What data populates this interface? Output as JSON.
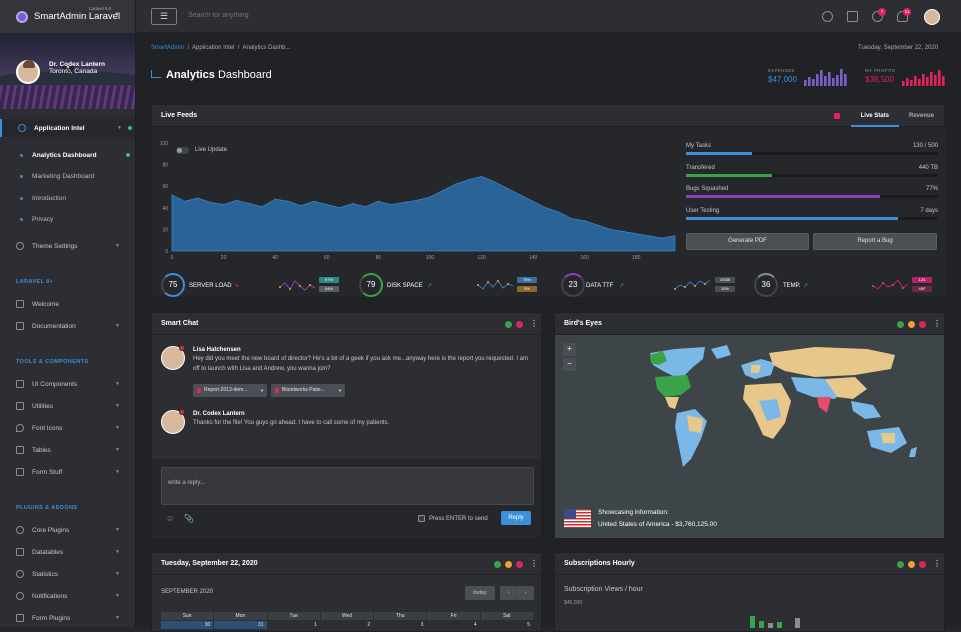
{
  "app": {
    "name": "SmartAdmin Laravel",
    "version": "Laravel 8.0"
  },
  "profile": {
    "name": "Dr. Codex Lantern",
    "location": "Toronto, Canada"
  },
  "sidebar": {
    "app_intel": "Application Intel",
    "sub_items": [
      "Analytics Dashboard",
      "Marketing Dashboard",
      "Introduction",
      "Privacy"
    ],
    "theme_settings": "Theme Settings",
    "section_laravel": "LARAVEL 8+",
    "welcome": "Welcome",
    "documentation": "Documentation",
    "section_tools": "TOOLS & COMPONENTS",
    "tools": [
      "UI Components",
      "Utilities",
      "Font Icons",
      "Tables",
      "Form Stuff"
    ],
    "section_plugins": "PLUGINS & ADDONS",
    "plugins": [
      "Core Plugins",
      "Datatables",
      "Statistics",
      "Notifications",
      "Form Plugins"
    ]
  },
  "topbar": {
    "search_placeholder": "Search for anything",
    "globe_badge": "7",
    "bell_badge": "11"
  },
  "breadcrumb": {
    "home": "SmartAdmin",
    "sep": "/",
    "section": "Application Intel",
    "page": "Analytics Dashb..."
  },
  "date": "Tuesday, September 22, 2020",
  "page": {
    "title_bold": "Analytics",
    "title_rest": "Dashboard"
  },
  "stats": {
    "expenses_label": "EXPENSES",
    "expenses_value": "$47,000",
    "expenses_color": "#7b5fc9",
    "profits_label": "MY PROFITS",
    "profits_value": "$38,500",
    "profits_color": "#e0245e"
  },
  "live_feeds": {
    "title": "Live Feeds",
    "tabs": [
      "Live Stats",
      "Revenue"
    ],
    "live_update": "Live Update",
    "y_ticks": [
      "100",
      "80",
      "60",
      "40",
      "20",
      "0"
    ],
    "x_ticks": [
      "0",
      "20",
      "40",
      "60",
      "80",
      "100",
      "120",
      "140",
      "160",
      "180"
    ],
    "progress": [
      {
        "label": "My Tasks",
        "value": "130 / 500",
        "fill": 0.26,
        "color": "#3c8fdb"
      },
      {
        "label": "Transfered",
        "value": "440 TB",
        "fill": 0.34,
        "color": "#3aa34a"
      },
      {
        "label": "Bugs Squashed",
        "value": "77%",
        "fill": 0.77,
        "color": "#8e3fbd"
      },
      {
        "label": "User Testing",
        "value": "7 days",
        "fill": 0.84,
        "color": "#3c8fdb"
      }
    ],
    "buttons": [
      "Generate PDF",
      "Report a Bug"
    ],
    "kpis": [
      {
        "value": "75",
        "label": "SERVER LOAD",
        "badges": [
          "97%",
          "44%"
        ],
        "color": "#3c8fdb"
      },
      {
        "value": "79",
        "label": "DISK SPACE",
        "badges": [
          "76%",
          "3%"
        ],
        "color": "#3aa34a"
      },
      {
        "value": "23",
        "label": "DATA TTF",
        "badges": [
          "10GB",
          "10%"
        ],
        "color": "#8e3fbd"
      },
      {
        "value": "36",
        "label": "TEMP.",
        "badges": [
          "124",
          "40F"
        ],
        "color": "#777a80"
      }
    ]
  },
  "chat": {
    "title": "Smart Chat",
    "messages": [
      {
        "name": "Lisa Hatchensen",
        "text": "Hey did you meet the new board of director? He's a bit of a geek if you ask me...anyway here is the report you requested. I am off to launch with Lisa and Andrew, you wanna join?"
      },
      {
        "name": "Dr. Codex Lantern",
        "text": "Thanks for the file! You guys go ahead, I have to call some of my patients."
      }
    ],
    "files": [
      "Report-2013-dem...",
      "Bloodworks Patie..."
    ],
    "reply_placeholder": "write a reply...",
    "enter_label": "Press ENTER to send",
    "reply_button": "Reply"
  },
  "birds_eye": {
    "title": "Bird's Eyes",
    "info_title": "Showcasing information:",
    "info_value": "United States of America - $3,760,125.00"
  },
  "calendar": {
    "title": "Tuesday, September 22, 2020",
    "month": "SEPTEMBER 2020",
    "today_btn": "today",
    "days": [
      "Sun",
      "Mon",
      "Tue",
      "Wed",
      "Thu",
      "Fri",
      "Sat"
    ],
    "nums": [
      "30",
      "31",
      "1",
      "2",
      "3",
      "4",
      "5"
    ]
  },
  "subs": {
    "title": "Subscriptions Hourly",
    "subtitle": "Subscription Views / hour",
    "tick": "$45,000"
  },
  "chart_data": {
    "type": "area",
    "title": "",
    "xlabel": "",
    "ylabel": "",
    "x": [
      0,
      5,
      10,
      15,
      20,
      25,
      30,
      35,
      40,
      45,
      50,
      55,
      60,
      65,
      70,
      75,
      80,
      85,
      90,
      95,
      100,
      105,
      110,
      115,
      120,
      125,
      130,
      135,
      140,
      145,
      150,
      155,
      160,
      165,
      170,
      175,
      180,
      185,
      190,
      195
    ],
    "values": [
      52,
      46,
      49,
      45,
      43,
      47,
      44,
      41,
      48,
      46,
      42,
      46,
      43,
      40,
      44,
      41,
      46,
      43,
      45,
      47,
      50,
      56,
      62,
      66,
      69,
      64,
      58,
      52,
      46,
      40,
      36,
      30,
      28,
      24,
      20,
      18,
      16,
      14,
      12,
      14
    ],
    "xlim": [
      0,
      195
    ],
    "ylim": [
      0,
      100
    ],
    "color": "#2a6496"
  }
}
